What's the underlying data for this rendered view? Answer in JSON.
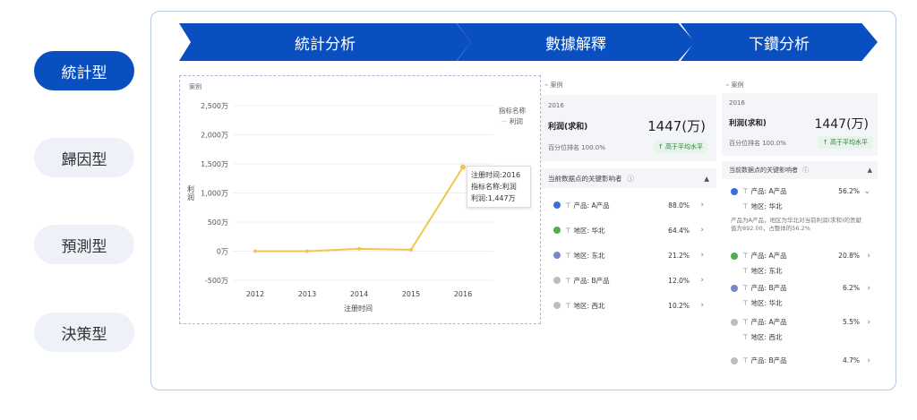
{
  "sidebar": {
    "items": [
      {
        "label": "統計型",
        "active": true
      },
      {
        "label": "歸因型",
        "active": false
      },
      {
        "label": "預測型",
        "active": false
      },
      {
        "label": "決策型",
        "active": false
      }
    ]
  },
  "steps": {
    "step1": "統計分析",
    "step2": "數據解釋",
    "step3": "下鑽分析"
  },
  "chart_panel": {
    "case_label": "案例",
    "y_axis_title": "利润",
    "x_axis_title": "注册时间",
    "legend_title": "指标名称",
    "legend_item": "利润",
    "tooltip": {
      "line1": "注册时间:2016",
      "line2": "指标名称:利润",
      "line3": "利润:1,447万"
    }
  },
  "chart_data": {
    "type": "line",
    "title": "",
    "xlabel": "注册时间",
    "ylabel": "利润",
    "x": [
      "2012",
      "2013",
      "2014",
      "2015",
      "2016"
    ],
    "series": [
      {
        "name": "利润",
        "values": [
          0,
          0,
          40,
          25,
          1447
        ]
      }
    ],
    "yticks": [
      "2,500万",
      "2,000万",
      "1,500万",
      "1,000万",
      "500万",
      "0万",
      "-500万"
    ],
    "ylim": [
      -500,
      2500
    ],
    "grid": true,
    "legend": "top-right",
    "color": "#f2c64e"
  },
  "interp_panel": {
    "case_label": "案例",
    "year": "2016",
    "metric_name": "利润(求和)",
    "metric_value": "1447(万)",
    "percentile": "百分位排名 100.0%",
    "badge": "高于平均水平",
    "section_title": "当前数据点的关键影响者",
    "rows": [
      {
        "label": "产品: A产品",
        "pct": "88.0%",
        "color": "#3a6fd8"
      },
      {
        "label": "地区: 华北",
        "pct": "64.4%",
        "color": "#4caf50"
      },
      {
        "label": "地区: 东北",
        "pct": "21.2%",
        "color": "#7986cb"
      },
      {
        "label": "产品: B产品",
        "pct": "12.0%",
        "color": "#bdbdbd"
      },
      {
        "label": "地区: 西北",
        "pct": "10.2%",
        "color": "#bdbdbd"
      }
    ]
  },
  "drill_panel": {
    "case_label": "案例",
    "year": "2016",
    "metric_name": "利润(求和)",
    "metric_value": "1447(万)",
    "percentile": "百分位排名 100.0%",
    "badge": "高于平均水平",
    "section_title": "当前数据点的关键影响者",
    "expanded": {
      "label": "产品: A产品",
      "pct": "56.2%",
      "sub": "地区: 华北",
      "desc": "产品为A产品，地区为华北对当前利润(求和)的贡献值为892.00，占整体的56.2%"
    },
    "rows": [
      {
        "label": "产品: A产品",
        "sub": "地区: 东北",
        "pct": "20.8%",
        "color": "#4caf50"
      },
      {
        "label": "产品: B产品",
        "sub": "地区: 华北",
        "pct": "6.2%",
        "color": "#7986cb"
      },
      {
        "label": "产品: A产品",
        "sub": "地区: 西北",
        "pct": "5.5%",
        "color": "#bdbdbd"
      },
      {
        "label": "产品: B产品",
        "sub": "",
        "pct": "4.7%",
        "color": "#bdbdbd"
      }
    ]
  }
}
